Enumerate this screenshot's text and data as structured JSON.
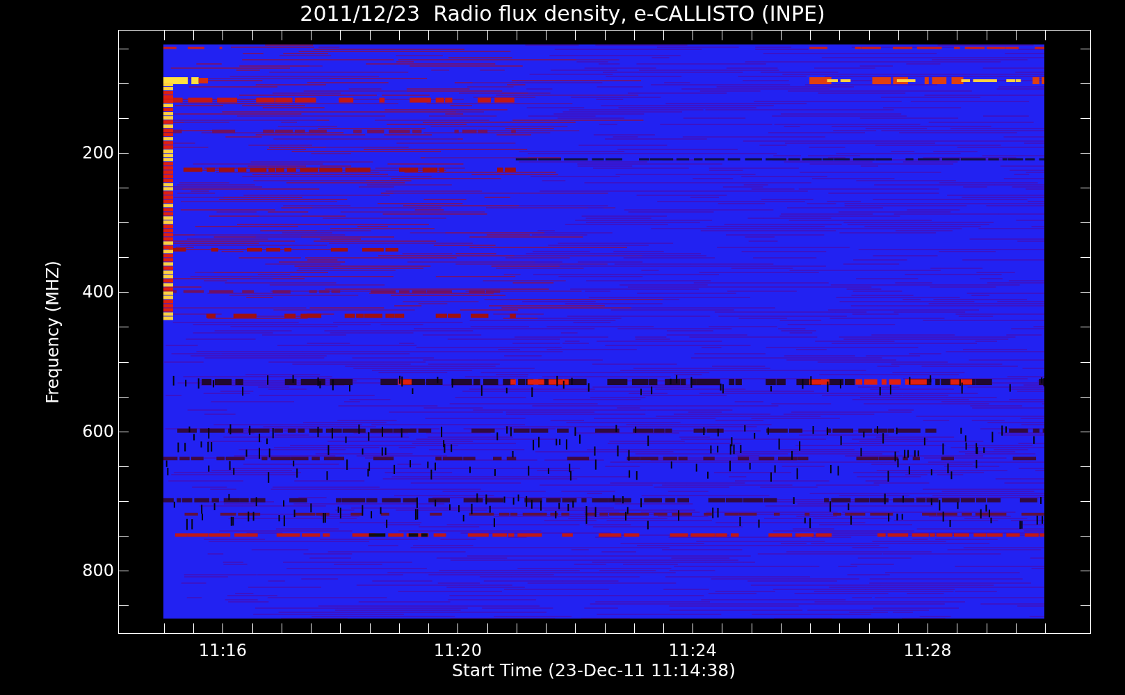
{
  "title": "2011/12/23  Radio flux density, e-CALLISTO (INPE)",
  "y_axis": {
    "label": "Frequency (MHZ)",
    "ticks": [
      "200",
      "400",
      "600",
      "800"
    ]
  },
  "x_axis": {
    "label": "Start Time (23-Dec-11 11:14:38)",
    "ticks": [
      "11:16",
      "11:20",
      "11:24",
      "11:28"
    ]
  }
}
